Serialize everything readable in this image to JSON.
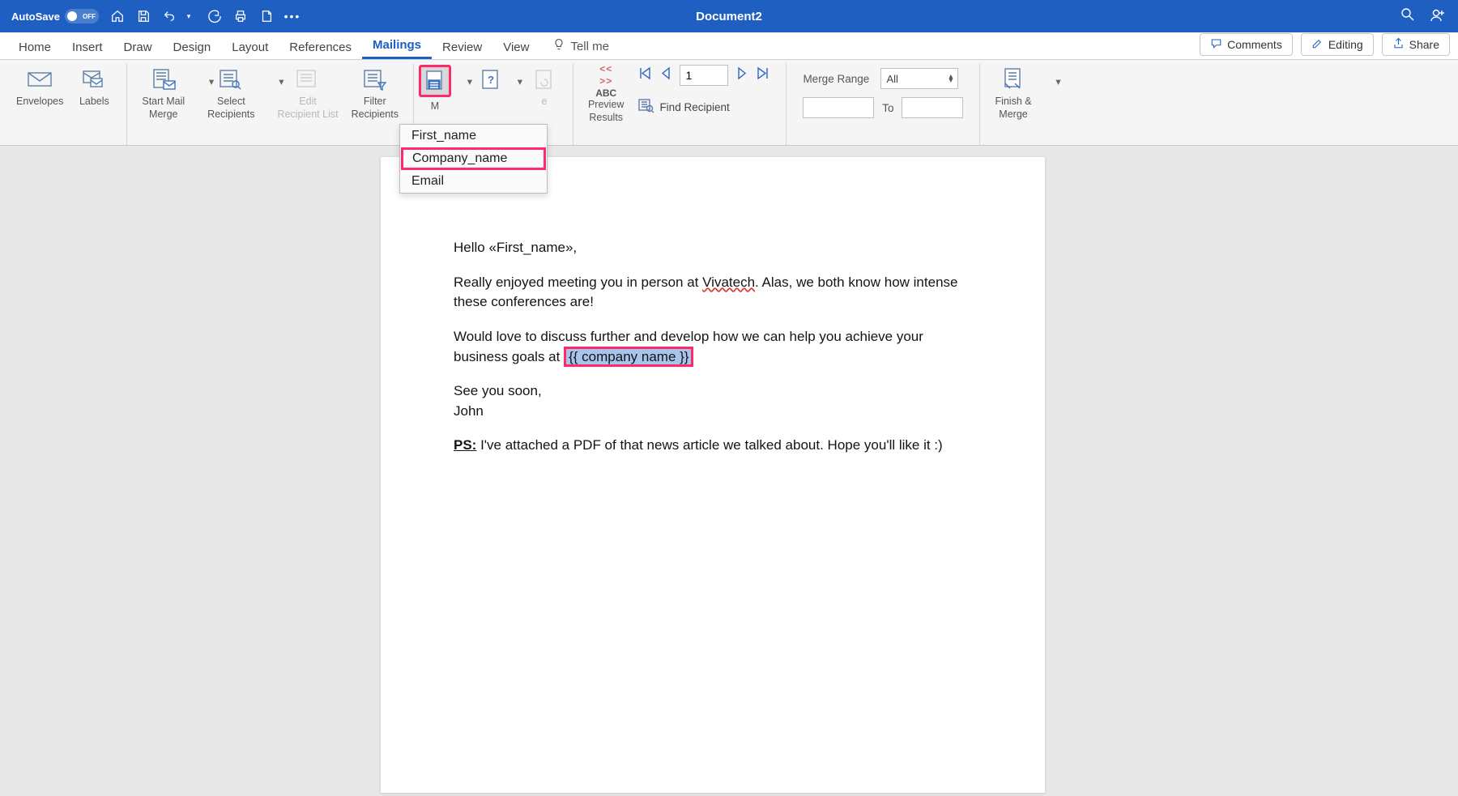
{
  "titlebar": {
    "autosave_label": "AutoSave",
    "autosave_state": "OFF",
    "document_title": "Document2"
  },
  "tabs": {
    "items": [
      "Home",
      "Insert",
      "Draw",
      "Design",
      "Layout",
      "References",
      "Mailings",
      "Review",
      "View"
    ],
    "active_index": 6,
    "tell_me": "Tell me"
  },
  "actions": {
    "comments": "Comments",
    "editing": "Editing",
    "share": "Share"
  },
  "ribbon": {
    "envelopes": "Envelopes",
    "labels": "Labels",
    "start_mail_merge": "Start Mail\nMerge",
    "select_recipients": "Select\nRecipients",
    "edit_recipient_list": "Edit\nRecipient List",
    "filter_recipients": "Filter\nRecipients",
    "insert_merge_field_partial": "M",
    "preview_results": "Preview\nResults",
    "find_recipient": "Find Recipient",
    "abc": "ABC",
    "record_value": "1",
    "merge_range_label": "Merge Range",
    "merge_range_value": "All",
    "to_label": "To",
    "finish_merge": "Finish &\nMerge"
  },
  "merge_field_menu": {
    "items": [
      "First_name",
      "Company_name",
      "Email"
    ],
    "selected_index": 1
  },
  "document": {
    "greeting_prefix": "Hello «",
    "greeting_field": "First_name",
    "greeting_suffix": "»,",
    "p1a": "Really enjoyed meeting you in person at ",
    "p1_spellerr": "Vivatech",
    "p1b": ". Alas, we both know how intense these conferences are!",
    "p2a": "Would love to discuss further and develop how we can help you achieve your business goals at ",
    "p2_field": "{{ company name }}",
    "p3": "See you soon,",
    "p4": "John",
    "ps_label": "PS:",
    "ps_text": " I've attached a PDF of that news article we talked about. Hope you'll like it :)"
  }
}
